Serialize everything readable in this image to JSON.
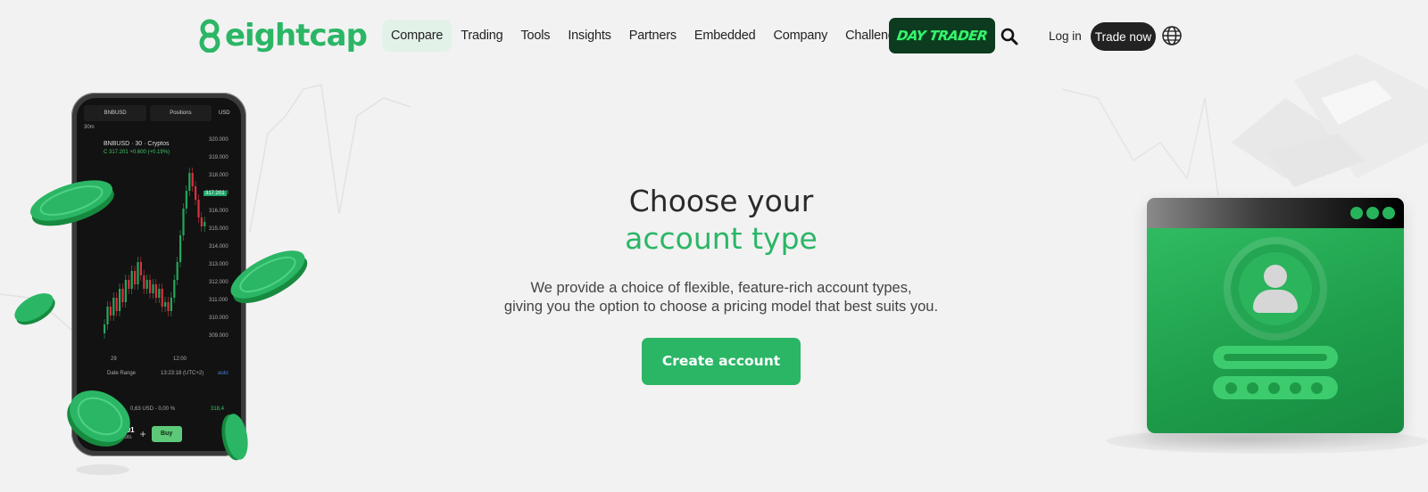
{
  "nav": {
    "logo_text": "eightcap",
    "items": [
      {
        "label": "Compare",
        "active": true
      },
      {
        "label": "Trading"
      },
      {
        "label": "Tools"
      },
      {
        "label": "Insights"
      },
      {
        "label": "Partners"
      },
      {
        "label": "Embedded"
      },
      {
        "label": "Company"
      },
      {
        "label": "Challenges"
      }
    ],
    "daytrader_label": "DAY TRADER",
    "search_icon": "search-icon",
    "login_label": "Log in",
    "trade_now_label": "Trade now",
    "globe_icon": "globe-icon"
  },
  "hero": {
    "title_line1": "Choose your",
    "title_line2": "account type",
    "subtitle_line1": "We provide a choice of flexible, feature-rich account types,",
    "subtitle_line2": "giving you the option to choose a pricing model that best suits you.",
    "cta_label": "Create account"
  },
  "phone": {
    "symbol_tab": "BNBUSD",
    "positions_tab": "Positions",
    "currency": "USD",
    "timeframe": "30m",
    "chart_title": "BNBUSD · 30 · Cryptos",
    "price_change": "C 317.201 +0.600 (+0.19%)",
    "price_label": "317.201",
    "price_axis": [
      "320.000",
      "319.000",
      "318.000",
      "317.000",
      "316.000",
      "315.000",
      "314.000",
      "313.000",
      "312.000",
      "311.000",
      "310.000",
      "309.000"
    ],
    "time_axis": [
      "29",
      "12:00"
    ],
    "date_range": "Date Range",
    "clock": "13:23:18 (UTC+2)",
    "auto": "auto",
    "margin_info": "0,63 USD - 0,00 %",
    "lots_value": "0.01",
    "lots_label": "lots",
    "buy_label": "Buy",
    "ask_price": "318,4"
  },
  "colors": {
    "brand_green": "#2bb666",
    "dark": "#222222",
    "daytrader_bg": "#0c3b1f",
    "daytrader_text": "#37f56f",
    "page_bg": "#f2f2f2"
  }
}
